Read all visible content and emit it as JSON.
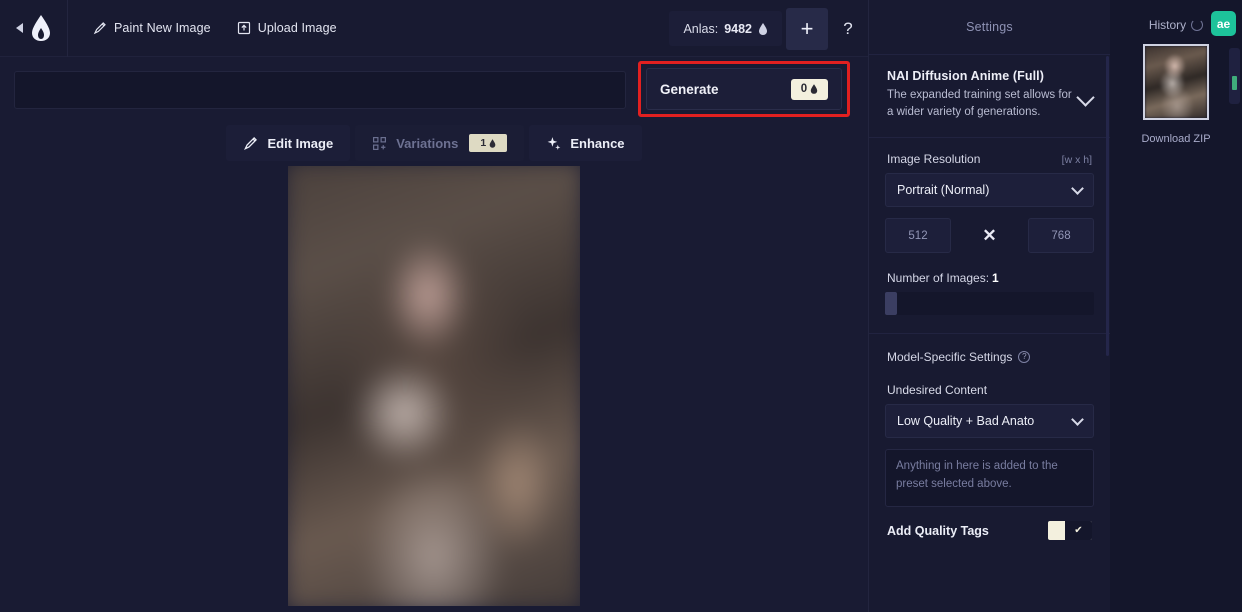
{
  "topbar": {
    "collapse_icon": "caret-left-icon",
    "logo_icon": "novelai-feather-logo",
    "paint_new_image": "Paint New Image",
    "paint_icon": "pen-icon",
    "upload_image": "Upload Image",
    "upload_icon": "upload-icon",
    "anlas_label": "Anlas:",
    "anlas_value": "9482",
    "anlas_icon": "anlas-icon",
    "plus_label": "+",
    "help_label": "?"
  },
  "prompt": {
    "value": "",
    "placeholder": ""
  },
  "generate": {
    "label": "Generate",
    "cost": "0",
    "cost_icon": "anlas-icon",
    "highlight_color": "#e22020"
  },
  "tools": {
    "edit_image": "Edit Image",
    "edit_icon": "brush-icon",
    "variations": "Variations",
    "variations_icon": "grid-plus-icon",
    "variations_badge": "1",
    "variations_badge_icon": "anlas-icon",
    "enhance": "Enhance",
    "enhance_icon": "sparkle-icon"
  },
  "settings": {
    "title": "Settings",
    "model": {
      "name": "NAI Diffusion Anime (Full)",
      "description": "The expanded training set allows for a wider variety of generations.",
      "chevron_icon": "chevron-down-icon"
    },
    "resolution": {
      "label": "Image Resolution",
      "hint": "[w x h]",
      "preset": "Portrait (Normal)",
      "preset_chevron_icon": "chevron-down-icon",
      "width": "512",
      "height": "768",
      "times_symbol": "✕"
    },
    "number_of_images": {
      "label": "Number of Images:",
      "value": "1"
    },
    "model_specific": {
      "label": "Model-Specific Settings",
      "info_icon": "info-icon",
      "info_glyph": "?"
    },
    "undesired_content": {
      "label": "Undesired Content",
      "preset": "Low Quality + Bad Anato",
      "preset_chevron_icon": "chevron-down-icon",
      "textarea_placeholder": "Anything in here is added to the preset selected above."
    },
    "quality_tags": {
      "label": "Add Quality Tags",
      "checked_glyph": "✔"
    }
  },
  "history": {
    "title": "History",
    "refresh_icon": "refresh-icon",
    "extension_badge": "ae",
    "extension_badge_color": "#1dc39a",
    "thumbnail_name": "history-thumbnail",
    "download_zip": "Download ZIP"
  },
  "colors": {
    "background": "#13152b",
    "panel": "#181a31",
    "accent_cream": "#f3f0de",
    "highlight_red": "#e22020"
  }
}
